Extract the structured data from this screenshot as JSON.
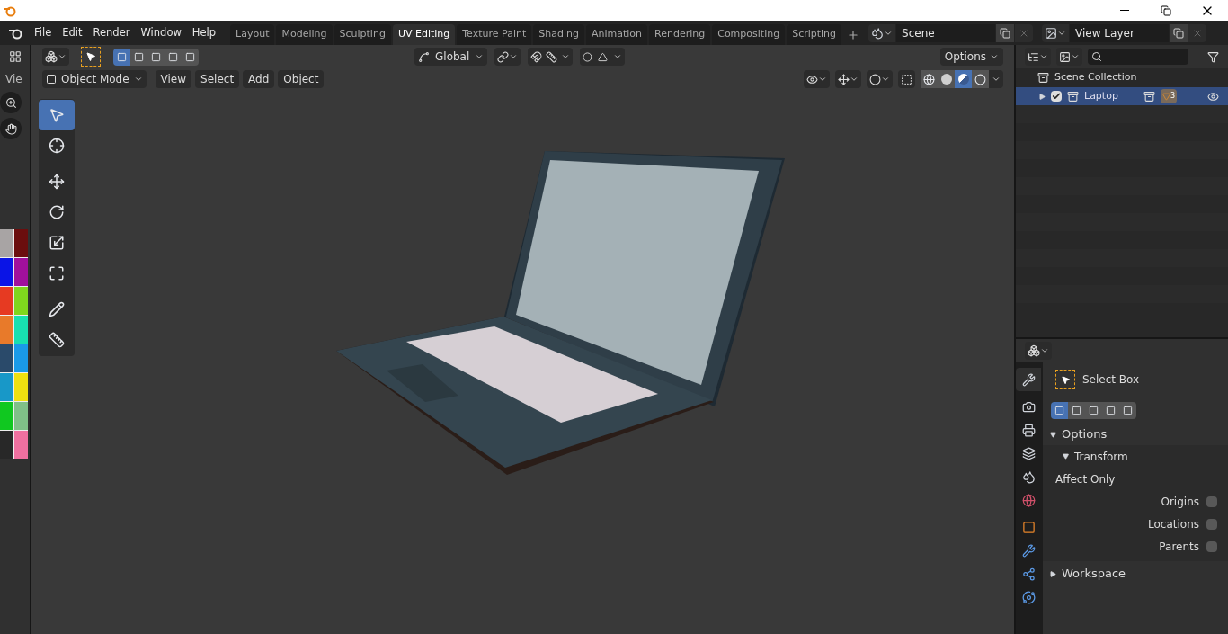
{
  "menu": [
    "File",
    "Edit",
    "Render",
    "Window",
    "Help"
  ],
  "workspaces": [
    {
      "label": "Layout",
      "selected": false
    },
    {
      "label": "Modeling",
      "selected": false
    },
    {
      "label": "Sculpting",
      "selected": false
    },
    {
      "label": "UV Editing",
      "selected": true
    },
    {
      "label": "Texture Paint",
      "selected": false
    },
    {
      "label": "Shading",
      "selected": false
    },
    {
      "label": "Animation",
      "selected": false
    },
    {
      "label": "Rendering",
      "selected": false
    },
    {
      "label": "Compositing",
      "selected": false
    },
    {
      "label": "Scripting",
      "selected": false
    }
  ],
  "scene": "Scene",
  "view_layer": "View Layer",
  "side_label": "Vie",
  "viewport": {
    "orientation": "Global",
    "options": "Options",
    "mode": "Object Mode",
    "menus": [
      "View",
      "Select",
      "Add",
      "Object"
    ],
    "select_modes": [
      {
        "selected": true
      },
      {
        "selected": false
      },
      {
        "selected": false
      },
      {
        "selected": false
      },
      {
        "selected": false
      }
    ],
    "shading": [
      {
        "kind": "wireframe",
        "selected": false
      },
      {
        "kind": "solid",
        "selected": false
      },
      {
        "kind": "material",
        "selected": true
      },
      {
        "kind": "rendered",
        "selected": false
      }
    ]
  },
  "tools": [
    {
      "kind": "select",
      "selected": true
    },
    {
      "kind": "cursor",
      "selected": false
    },
    {
      "kind": "move",
      "selected": false
    },
    {
      "kind": "rotate",
      "selected": false
    },
    {
      "kind": "scale",
      "selected": false
    },
    {
      "kind": "transform",
      "selected": false
    },
    {
      "kind": "annotate",
      "selected": false
    },
    {
      "kind": "measure",
      "selected": false
    }
  ],
  "palette": [
    {
      "color": "#a8a4a4"
    },
    {
      "color": "#6b0e0e"
    },
    {
      "color": "#0a14e6"
    },
    {
      "color": "#a0109c"
    },
    {
      "color": "#e63a22"
    },
    {
      "color": "#80d61e"
    },
    {
      "color": "#e87a2a"
    },
    {
      "color": "#18e0b0"
    },
    {
      "color": "#2a4a6a"
    },
    {
      "color": "#1a9ae8"
    },
    {
      "color": "#1898c8"
    },
    {
      "color": "#f0e010"
    },
    {
      "color": "#10c820"
    },
    {
      "color": "#80c088"
    },
    {
      "color": "#282828"
    },
    {
      "color": "#f070a0"
    }
  ],
  "outliner": {
    "root": "Scene Collection",
    "items": [
      {
        "name": "Laptop",
        "checked": true,
        "selected": true,
        "count": "3"
      }
    ]
  },
  "properties": {
    "tabs": [
      {
        "kind": "tool",
        "selected": true
      },
      {
        "kind": "render",
        "selected": false
      },
      {
        "kind": "output",
        "selected": false
      },
      {
        "kind": "view_layer",
        "selected": false
      },
      {
        "kind": "scene",
        "selected": false
      },
      {
        "kind": "world",
        "selected": false
      },
      {
        "kind": "object",
        "selected": false
      },
      {
        "kind": "modifiers",
        "selected": false
      },
      {
        "kind": "particles",
        "selected": false
      },
      {
        "kind": "physics",
        "selected": false
      }
    ],
    "tool": "Select Box",
    "select_modes": [
      {
        "selected": true
      },
      {
        "selected": false
      },
      {
        "selected": false
      },
      {
        "selected": false
      },
      {
        "selected": false
      }
    ],
    "options": {
      "title": "Options",
      "expanded": true,
      "transform": {
        "title": "Transform",
        "expanded": true
      }
    },
    "affect_label": "Affect Only",
    "checkboxes": [
      {
        "label": "Origins",
        "checked": false
      },
      {
        "label": "Locations",
        "checked": false
      },
      {
        "label": "Parents",
        "checked": false
      }
    ],
    "workspace": {
      "title": "Workspace",
      "expanded": false
    }
  }
}
